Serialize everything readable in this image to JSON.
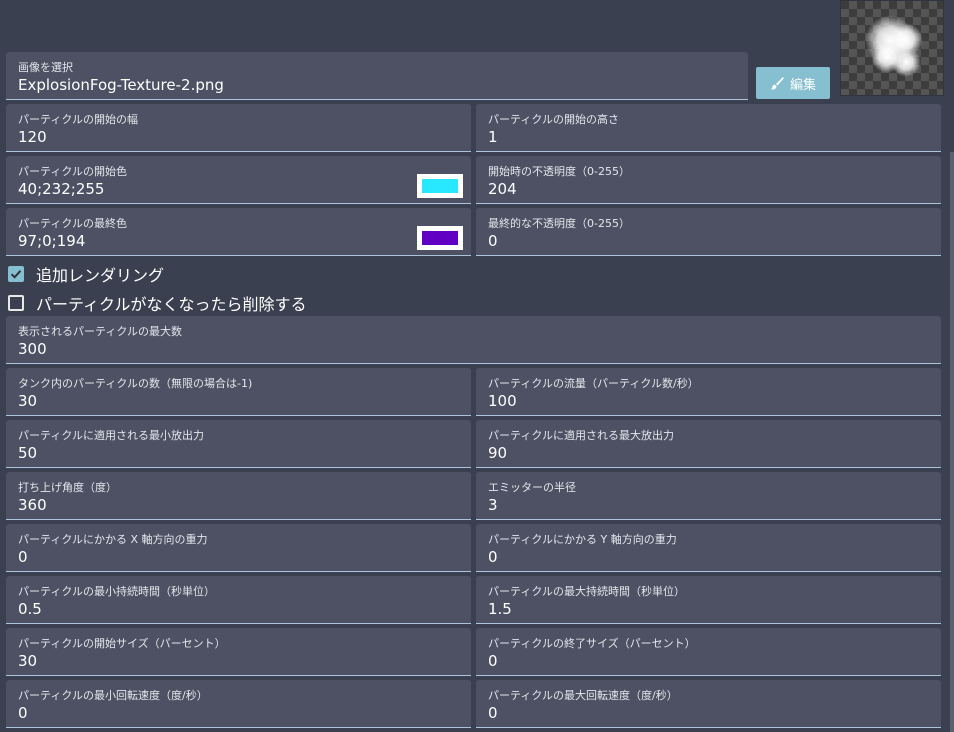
{
  "texture": {
    "label": "画像を選択",
    "value": "ExplosionFog-Texture-2.png",
    "edit_button": "編集"
  },
  "fields": {
    "start_width": {
      "label": "パーティクルの開始の幅",
      "value": "120"
    },
    "start_height": {
      "label": "パーティクルの開始の高さ",
      "value": "1"
    },
    "start_color": {
      "label": "パーティクルの開始色",
      "value": "40;232;255",
      "swatch": "#28e8ff"
    },
    "start_opacity": {
      "label": "開始時の不透明度（0-255）",
      "value": "204"
    },
    "end_color": {
      "label": "パーティクルの最終色",
      "value": "97;0;194",
      "swatch": "#6100c2"
    },
    "end_opacity": {
      "label": "最終的な不透明度（0-255）",
      "value": "0"
    },
    "max_count": {
      "label": "表示されるパーティクルの最大数",
      "value": "300"
    },
    "tank_count": {
      "label": "タンク内のパーティクルの数（無限の場合は-1)",
      "value": "30"
    },
    "flow": {
      "label": "パーティクルの流量（パーティクル数/秒）",
      "value": "100"
    },
    "min_force": {
      "label": "パーティクルに適用される最小放出力",
      "value": "50"
    },
    "max_force": {
      "label": "パーティクルに適用される最大放出力",
      "value": "90"
    },
    "angle": {
      "label": "打ち上げ角度（度）",
      "value": "360"
    },
    "radius": {
      "label": "エミッターの半径",
      "value": "3"
    },
    "gravity_x": {
      "label": "パーティクルにかかる X 軸方向の重力",
      "value": "0"
    },
    "gravity_y": {
      "label": "パーティクルにかかる Y 軸方向の重力",
      "value": "0"
    },
    "min_life": {
      "label": "パーティクルの最小持続時間（秒単位）",
      "value": "0.5"
    },
    "max_life": {
      "label": "パーティクルの最大持続時間（秒単位）",
      "value": "1.5"
    },
    "start_size": {
      "label": "パーティクルの開始サイズ（パーセント）",
      "value": "30"
    },
    "end_size": {
      "label": "パーティクルの終了サイズ（パーセント）",
      "value": "0"
    },
    "min_rotation": {
      "label": "パーティクルの最小回転速度（度/秒）",
      "value": "0"
    },
    "max_rotation": {
      "label": "パーティクルの最大回転速度（度/秒）",
      "value": "0"
    }
  },
  "checkboxes": {
    "additive": {
      "label": "追加レンダリング",
      "checked": true
    },
    "delete_when_empty": {
      "label": "パーティクルがなくなったら削除する",
      "checked": false
    }
  },
  "colors": {
    "background": "#3b4050",
    "field_bg": "#4d5163",
    "accent": "#86bfcf"
  },
  "icons": {
    "edit": "brush-icon",
    "check": "check-icon"
  }
}
